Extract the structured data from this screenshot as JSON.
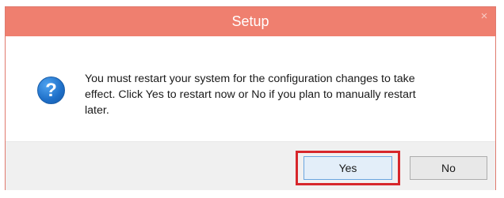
{
  "window": {
    "title": "Setup",
    "close_glyph": "×"
  },
  "message": {
    "icon": "question-icon",
    "icon_glyph": "?",
    "lines": [
      "You must restart your system for the configuration changes to take",
      "effect. Click Yes to restart now or No if you plan to manually restart",
      "later."
    ]
  },
  "buttons": {
    "yes_label": "Yes",
    "no_label": "No"
  },
  "colors": {
    "titlebar": "#ef7f6f",
    "highlight": "#d7262b",
    "icon": "#1e6fc8"
  }
}
